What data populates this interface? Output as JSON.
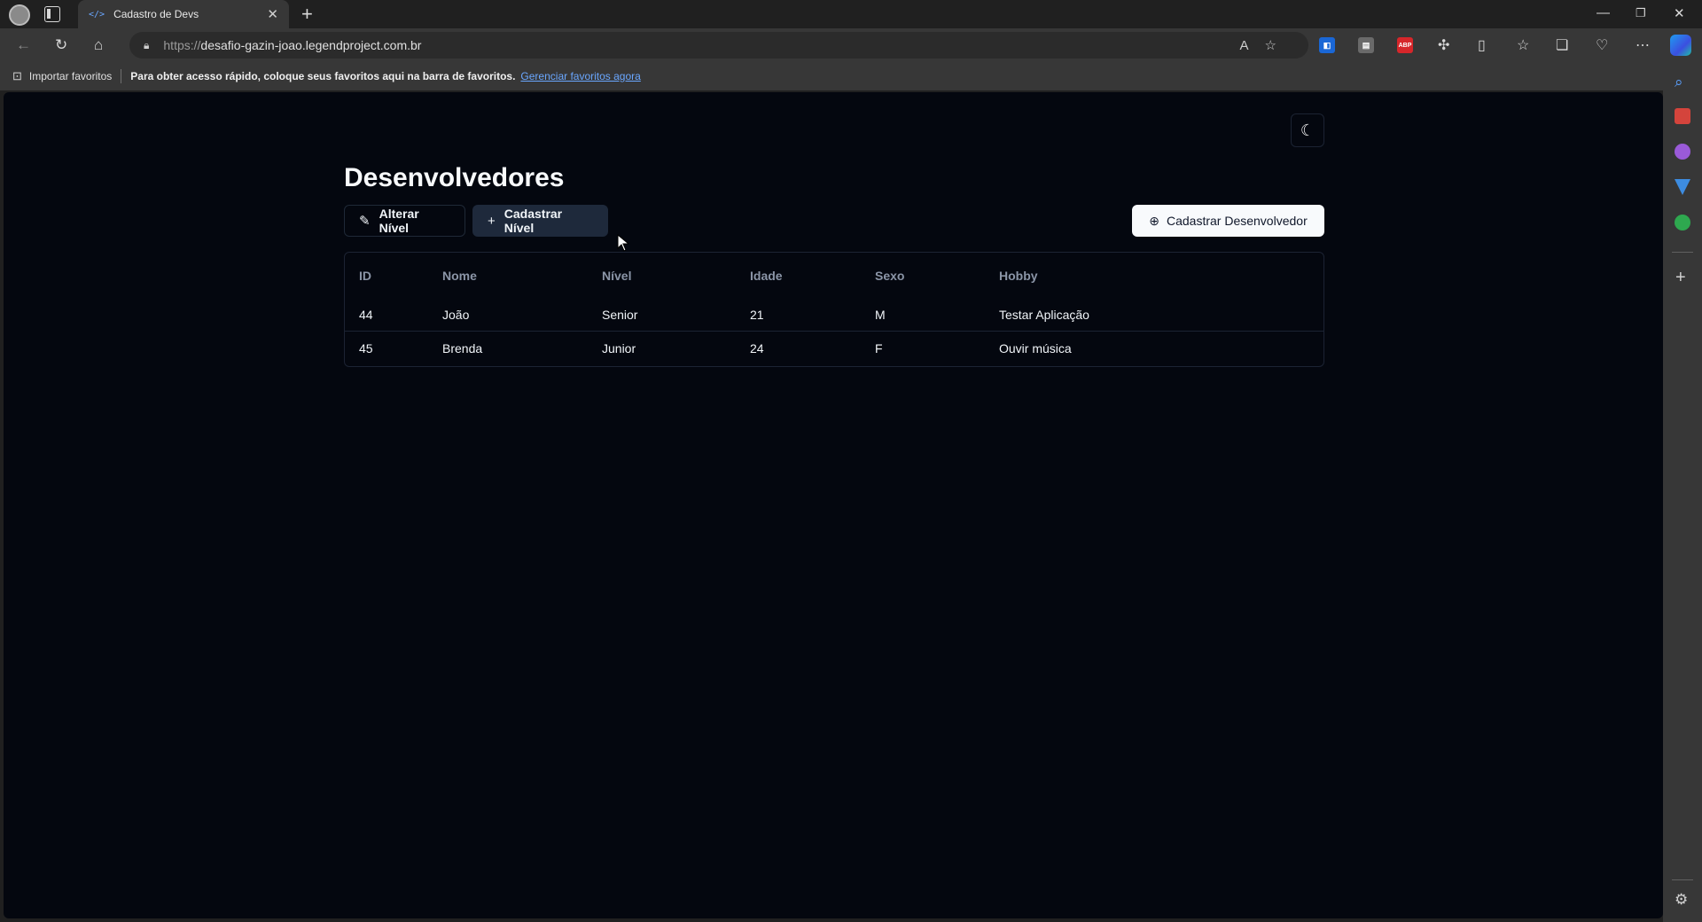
{
  "browser": {
    "tab_title": "Cadastro de Devs",
    "tab_icon": "</>",
    "url_protocol": "https://",
    "url_host": "desafio-gazin-joao.legendproject.com.br",
    "ext_abp": "ABP",
    "favorites": {
      "import_label": "Importar favoritos",
      "message": "Para obter acesso rápido, coloque seus favoritos aqui na barra de favoritos.",
      "manage_link": "Gerenciar favoritos agora"
    }
  },
  "page": {
    "title": "Desenvolvedores",
    "buttons": {
      "edit_level": "Alterar Nível",
      "add_level": "Cadastrar Nível",
      "add_developer": "Cadastrar Desenvolvedor"
    },
    "table": {
      "headers": [
        "ID",
        "Nome",
        "Nível",
        "Idade",
        "Sexo",
        "Hobby"
      ],
      "rows": [
        [
          "44",
          "João",
          "Senior",
          "21",
          "M",
          "Testar Aplicação"
        ],
        [
          "45",
          "Brenda",
          "Junior",
          "24",
          "F",
          "Ouvir música"
        ]
      ]
    }
  },
  "colors": {
    "page_background": "#04070f",
    "primary_button": "#f8fafc",
    "secondary_button": "#1e293b",
    "link": "#6aa7ff"
  }
}
